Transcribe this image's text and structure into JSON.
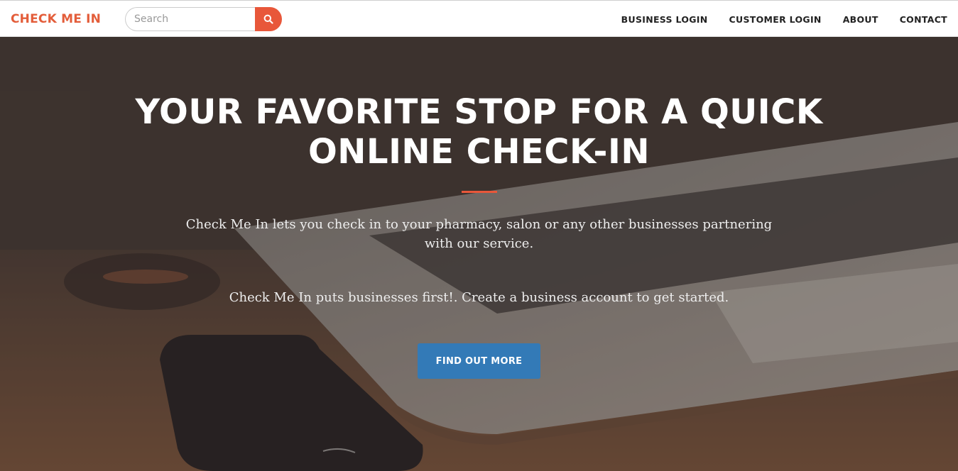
{
  "brand": "CHECK ME IN",
  "search": {
    "placeholder": "Search",
    "value": "",
    "icon": "search-icon"
  },
  "nav": {
    "items": [
      {
        "label": "BUSINESS LOGIN"
      },
      {
        "label": "CUSTOMER LOGIN"
      },
      {
        "label": "ABOUT"
      },
      {
        "label": "CONTACT"
      }
    ]
  },
  "hero": {
    "title": "YOUR FAVORITE STOP FOR A QUICK ONLINE CHECK-IN",
    "text1": "Check Me In lets you check in to your pharmacy, salon or any other businesses partnering with our service.",
    "text2": "Check Me In puts businesses first!. Create a business account to get started.",
    "cta_label": "FIND OUT MORE"
  },
  "colors": {
    "brand": "#e35d3a",
    "accent": "#e8573a",
    "cta": "#337ab7",
    "navbar_bg": "#ffffff"
  }
}
